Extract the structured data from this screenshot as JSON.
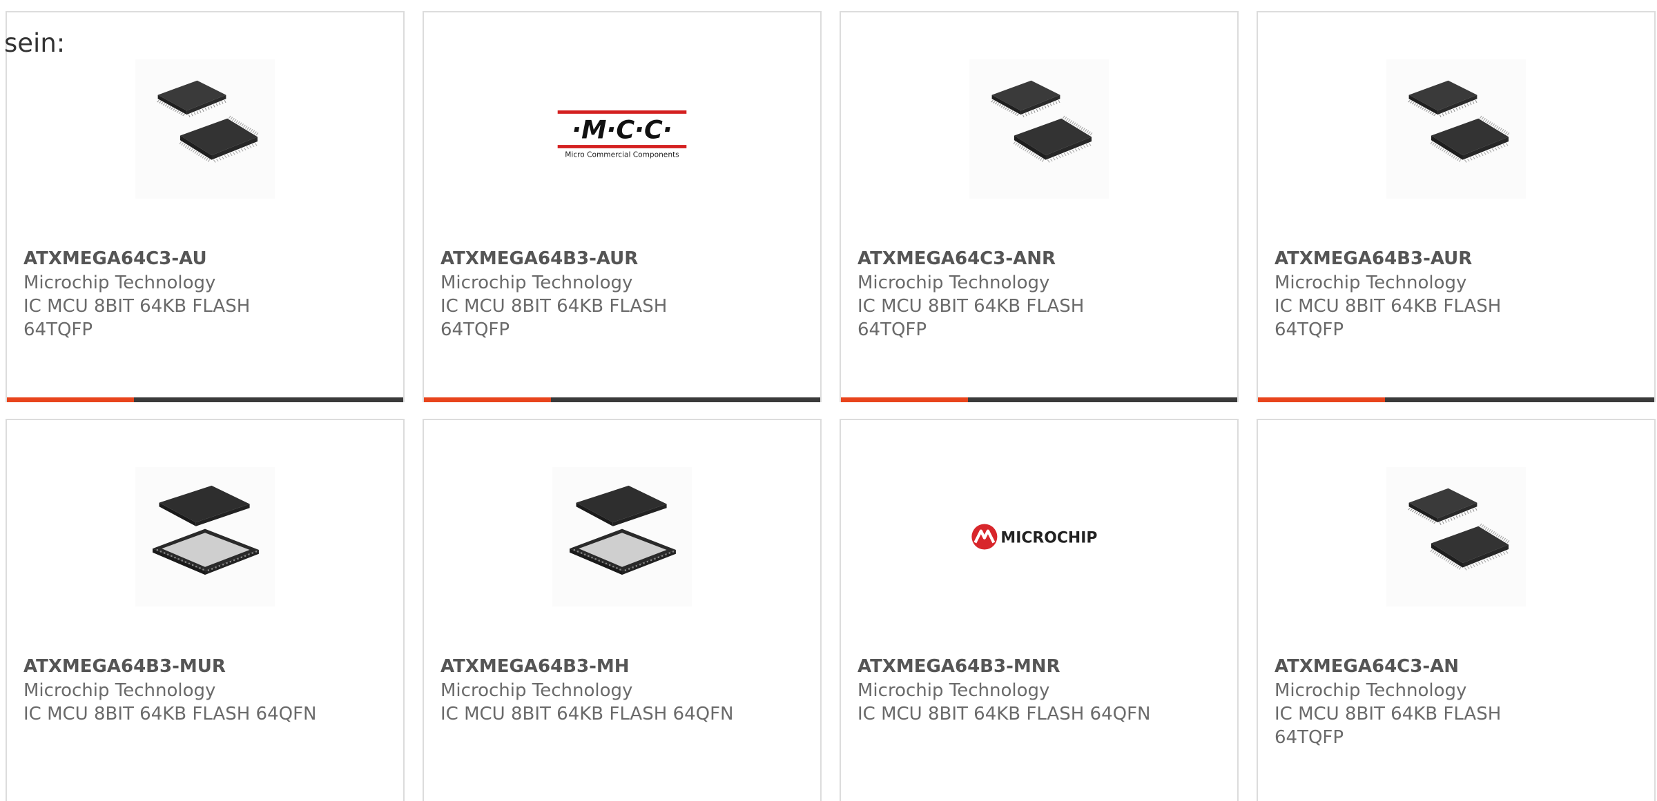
{
  "intro_text": "sein:",
  "colors": {
    "accent": "#e8441c",
    "bar_track": "#3a3a3a",
    "card_border": "#dcdcdc",
    "part_number": "#555555",
    "body_text": "#6a6a6a"
  },
  "products": [
    {
      "part_number": "ATXMEGA64C3-AU",
      "manufacturer": "Microchip Technology",
      "description": "IC MCU 8BIT 64KB FLASH 64TQFP",
      "image": "tqfp-chip-image",
      "progress": 0.32
    },
    {
      "part_number": "ATXMEGA64B3-AUR",
      "manufacturer": "Microchip Technology",
      "description": "IC MCU 8BIT 64KB FLASH 64TQFP",
      "image": "mcc-logo",
      "logo_text": "·M·C·C·",
      "logo_subtext": "Micro Commercial Components",
      "progress": 0.32
    },
    {
      "part_number": "ATXMEGA64C3-ANR",
      "manufacturer": "Microchip Technology",
      "description": "IC MCU 8BIT 64KB FLASH 64TQFP",
      "image": "tqfp-chip-image",
      "progress": 0.32
    },
    {
      "part_number": "ATXMEGA64B3-AUR",
      "manufacturer": "Microchip Technology",
      "description": "IC MCU 8BIT 64KB FLASH 64TQFP",
      "image": "tqfp-chip-image",
      "progress": 0.32
    },
    {
      "part_number": "ATXMEGA64B3-MUR",
      "manufacturer": "Microchip Technology",
      "description": "IC MCU 8BIT 64KB FLASH 64QFN",
      "image": "qfn-chip-image"
    },
    {
      "part_number": "ATXMEGA64B3-MH",
      "manufacturer": "Microchip Technology",
      "description": "IC MCU 8BIT 64KB FLASH 64QFN",
      "image": "qfn-chip-image"
    },
    {
      "part_number": "ATXMEGA64B3-MNR",
      "manufacturer": "Microchip Technology",
      "description": "IC MCU 8BIT 64KB FLASH 64QFN",
      "image": "microchip-logo",
      "logo_text": "MICROCHIP"
    },
    {
      "part_number": "ATXMEGA64C3-AN",
      "manufacturer": "Microchip Technology",
      "description": "IC MCU 8BIT 64KB FLASH 64TQFP",
      "image": "tqfp-chip-image"
    }
  ]
}
